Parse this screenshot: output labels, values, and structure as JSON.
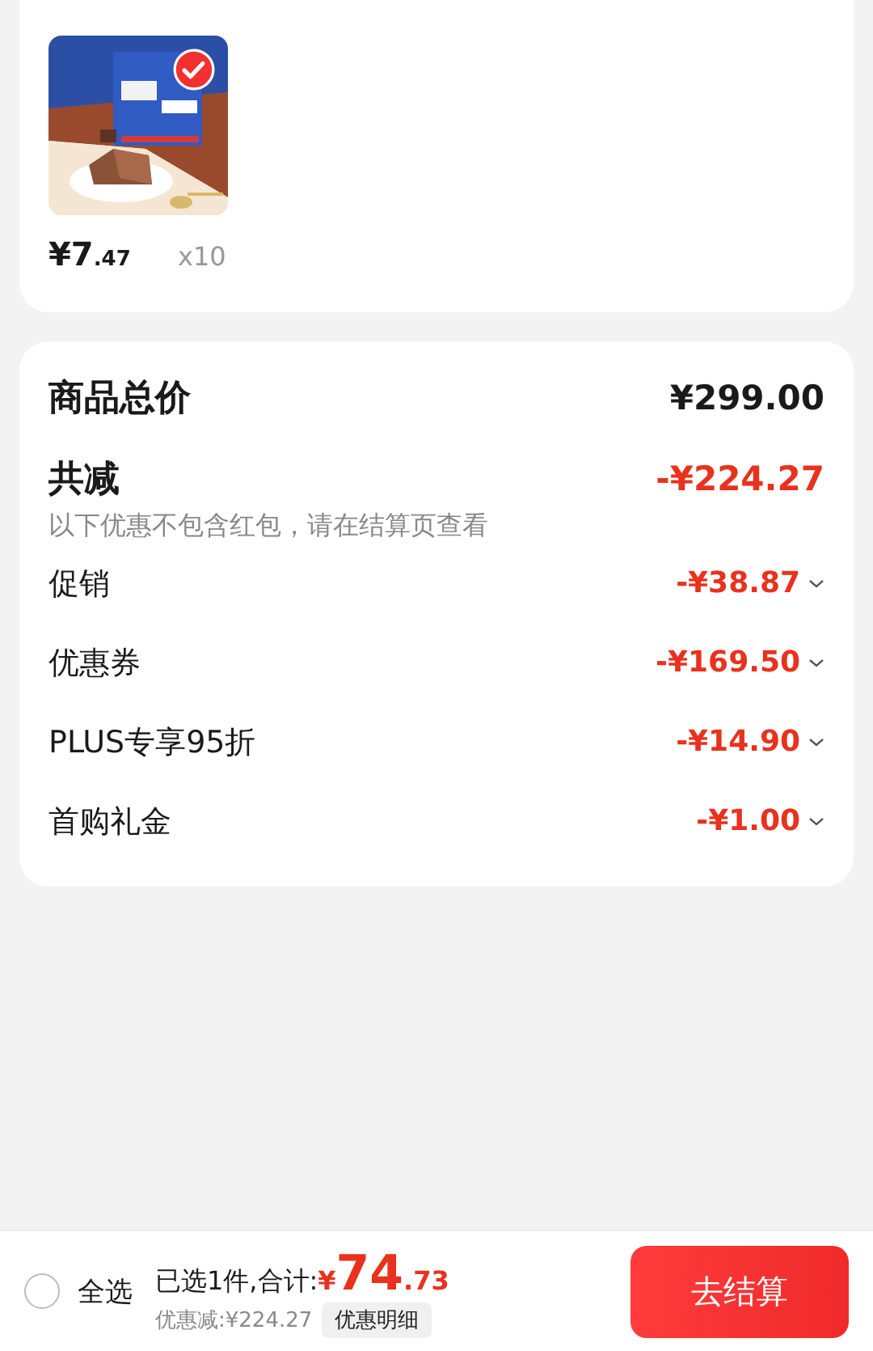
{
  "product": {
    "selected": true,
    "price": {
      "currency": "¥",
      "integer": "7",
      "decimal": ".47"
    },
    "quantity": "x10"
  },
  "summary": {
    "total": {
      "label": "商品总价",
      "value": "¥299.00"
    },
    "discount": {
      "label": "共减",
      "value": "-¥224.27",
      "note": "以下优惠不包含红包，请在结算页查看"
    },
    "items": [
      {
        "label": "促销",
        "value": "-¥38.87",
        "expanded": false
      },
      {
        "label": "优惠券",
        "value": "-¥169.50",
        "expanded": false
      },
      {
        "label": "PLUS专享95折",
        "value": "-¥14.90",
        "expanded": false
      },
      {
        "label": "首购礼金",
        "value": "-¥1.00",
        "expanded": false
      }
    ]
  },
  "bottom_bar": {
    "select_all": {
      "label": "全选",
      "checked": false
    },
    "selected_text": "已选1件,合计:",
    "total": {
      "currency": "¥",
      "integer": "74",
      "decimal": ".73"
    },
    "saved": "优惠减:¥224.27",
    "details_button": "优惠明细",
    "checkout_button": "去结算"
  }
}
